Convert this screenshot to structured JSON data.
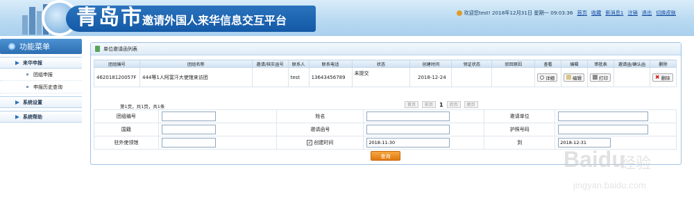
{
  "header": {
    "title_main": "青岛市",
    "title_sub": "邀请外国人来华信息交互平台",
    "welcome": "欢迎您test! 2018年12月31日 星期一 09:03:36",
    "links": [
      "首页",
      "收藏",
      "新消息1",
      "注销",
      "退出",
      "切换皮肤"
    ]
  },
  "sidebar": {
    "title": "功能菜单",
    "sections": [
      {
        "label": "来华申报",
        "items": [
          "团组申报",
          "申报历史查询"
        ]
      },
      {
        "label": "系统设置",
        "items": []
      },
      {
        "label": "系统帮助",
        "items": []
      }
    ]
  },
  "panel": {
    "title": "单位邀请函列表",
    "columns": [
      "团组编号",
      "团组名称",
      "邀请/核实函号",
      "联系人",
      "联系电话",
      "状态",
      "创建时间",
      "领证状态",
      "驳回原因",
      "查看",
      "编辑",
      "审批表",
      "邀请函/确认函",
      "删除"
    ],
    "rows": [
      {
        "group_no": "462018120057F",
        "group_name": "444等1人阿富汗大使馆来访团",
        "letter_no": "",
        "contact": "test",
        "phone": "13643456789",
        "status": "未提交",
        "created": "2018-12-24",
        "license_status": "",
        "reject_reason": "",
        "view": "详细",
        "edit": "编辑",
        "print": "打印",
        "letter": "",
        "delete": "删除"
      }
    ],
    "pager_info": "第1页，共1页，共1条",
    "pager": {
      "first": "首页",
      "prev": "前页",
      "current": "1",
      "next": "后页",
      "last": "尾页"
    }
  },
  "form": {
    "group_no_label": "团组编号",
    "group_no_value": "",
    "name_label": "姓名",
    "name_value": "",
    "unit_label": "邀请单位",
    "unit_value": "",
    "nationality_label": "国籍",
    "nationality_value": "",
    "letter_label": "邀请函号",
    "letter_value": "",
    "passport_label": "护照号码",
    "passport_value": "",
    "embassy_label": "驻外使领馆",
    "embassy_value": "",
    "created_label": "创建时间",
    "created_checked": true,
    "created_from": "2018-11-30",
    "to_label": "到",
    "created_to": "2018-12-31",
    "query_button": "查询"
  },
  "watermark": {
    "brand": "Baidu",
    "brand_cn": "经验",
    "url": "jingyan.baidu.com"
  }
}
